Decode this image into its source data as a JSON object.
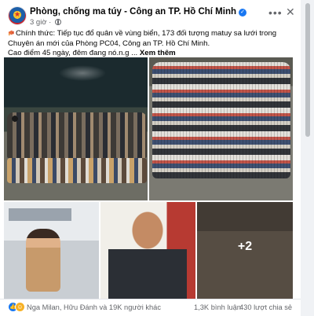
{
  "post": {
    "page_name": "Phòng, chống ma túy - Công an TP. Hồ Chí Minh",
    "time": "3 giờ",
    "text_lead": "Chính thức: Tiếp tục đổ quân về vùng biển, 173 đối tượng matuy sa lưới trong Chuyên án mới của Phòng PC04, Công an TP. Hồ Chí Minh.",
    "text_line2": "Cao điểm 45 ngày, đêm đang nó.n.g ...",
    "see_more": "Xem thêm",
    "more_photos": "+2"
  },
  "footer": {
    "reactors": "Nga Milan, Hữu Đánh và 19K người khác",
    "comments": "1,3K bình luận",
    "shares": "430 lượt chia sẻ"
  },
  "icons": {
    "more": "more-horizontal-icon",
    "close": "close-icon",
    "audience": "globe-icon",
    "verified": "verified-badge-icon",
    "like": "like-reaction-icon",
    "haha": "haha-reaction-icon",
    "megaphone": "megaphone-emoji-icon"
  },
  "colors": {
    "accent": "#1877f2",
    "secondary_text": "#65676b",
    "background": "#f0f2f5"
  }
}
